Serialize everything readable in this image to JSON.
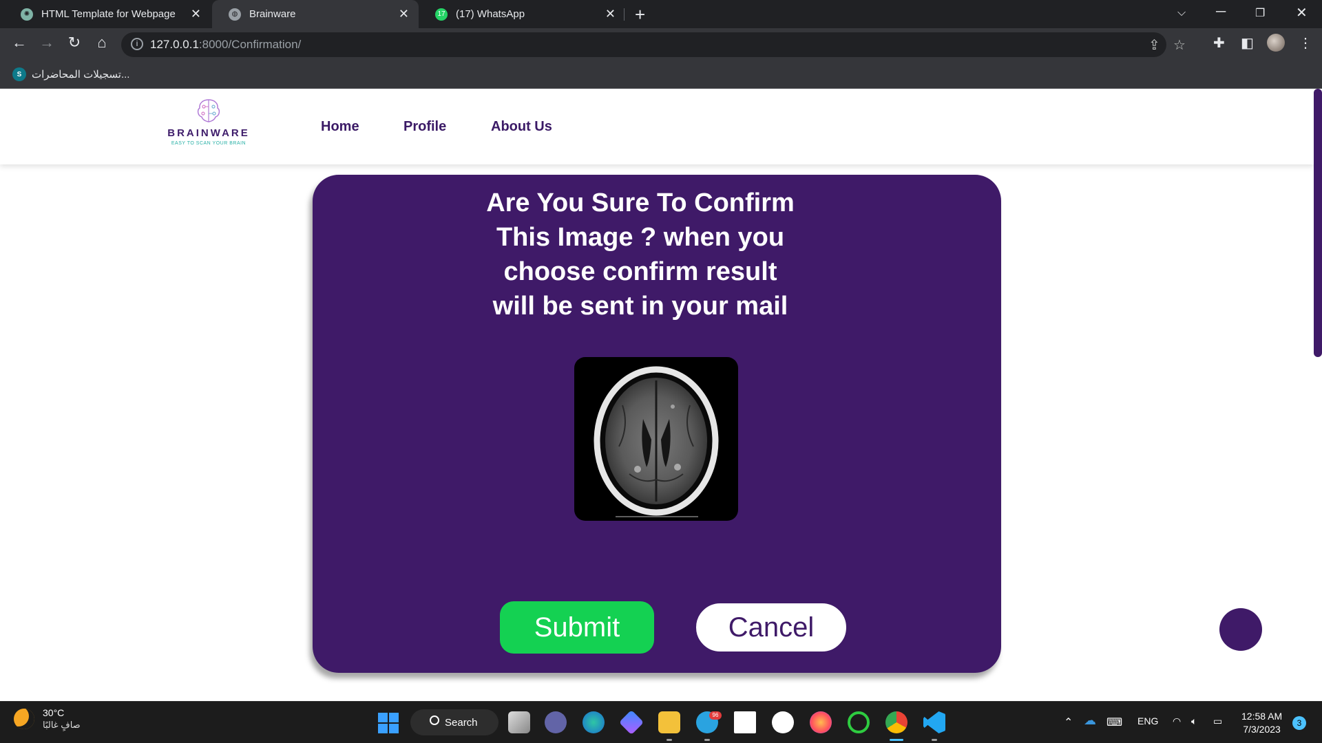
{
  "browser": {
    "tabs": [
      {
        "title": "HTML Template for Webpage",
        "icon": "chatgpt-icon"
      },
      {
        "title": "Brainware",
        "icon": "globe-icon",
        "active": true
      },
      {
        "title": "(17) WhatsApp",
        "icon": "whatsapp-icon",
        "badge": "17"
      }
    ],
    "new_tab": "+",
    "url_host": "127.0.0.1",
    "url_path": ":8000/Confirmation/",
    "bookmarks": [
      {
        "label": "تسجيلات المحاضرات...",
        "icon_text": "S"
      }
    ]
  },
  "site": {
    "brand": "BRAINWARE",
    "tagline": "EASY TO SCAN YOUR BRAIN",
    "nav": [
      "Home",
      "Profile",
      "About Us"
    ],
    "colors": {
      "primary": "#3f1a68",
      "submit": "#14d152",
      "tagline": "#27b0a6"
    }
  },
  "confirmation": {
    "title_lines": [
      "Are You Sure To Confirm",
      "This Image ? when you",
      "choose confirm result",
      "will be sent in your mail"
    ],
    "submit_label": "Submit",
    "cancel_label": "Cancel"
  },
  "taskbar": {
    "weather_temp": "30°C",
    "weather_condition": "صافٍ غالبًا",
    "search_label": "Search",
    "language": "ENG",
    "time": "12:58 AM",
    "date": "7/3/2023",
    "notifications": "3",
    "telegram_badge": "96"
  }
}
